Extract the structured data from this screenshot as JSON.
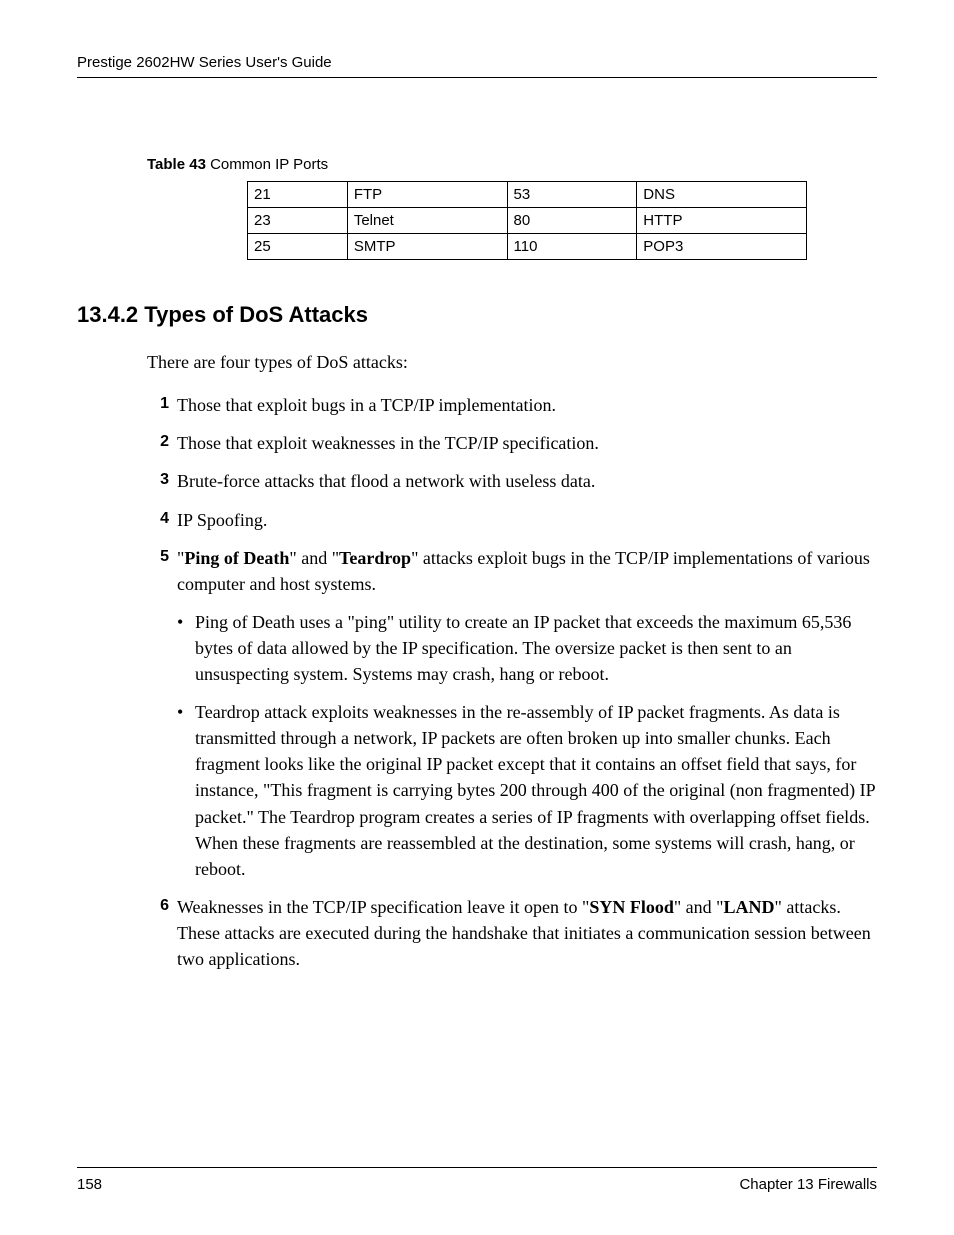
{
  "header": {
    "title": "Prestige 2602HW Series User's Guide"
  },
  "table": {
    "label_bold": "Table 43",
    "label_rest": "   Common IP Ports",
    "rows": [
      {
        "c1": "21",
        "c2": "FTP",
        "c3": "53",
        "c4": "DNS"
      },
      {
        "c1": "23",
        "c2": "Telnet",
        "c3": "80",
        "c4": "HTTP"
      },
      {
        "c1": "25",
        "c2": "SMTP",
        "c3": "110",
        "c4": "POP3"
      }
    ]
  },
  "section": {
    "heading": "13.4.2  Types of DoS Attacks",
    "intro": "There are four types of DoS attacks:",
    "items": {
      "n1": "1",
      "t1": "Those that exploit bugs in a TCP/IP implementation.",
      "n2": "2",
      "t2": "Those that exploit weaknesses in the TCP/IP specification.",
      "n3": "3",
      "t3": "Brute-force attacks that flood a network with useless data.",
      "n4": "4",
      "t4": "IP Spoofing.",
      "n5": "5",
      "t5a": "\"",
      "t5b": "Ping of Death",
      "t5c": "\" and \"",
      "t5d": "Teardrop",
      "t5e": "\" attacks exploit bugs in the TCP/IP implementations of various computer and host systems.",
      "sub1": "Ping of Death uses a \"ping\" utility to create an IP packet that exceeds the maximum 65,536 bytes of data allowed by the IP specification. The oversize packet is then sent to an unsuspecting system. Systems may crash, hang or reboot.",
      "sub2": "Teardrop attack exploits weaknesses in the re-assembly of IP packet fragments. As data is transmitted through a network, IP packets are often broken up into smaller chunks. Each fragment looks like the original IP packet except that it contains an offset field that says, for instance, \"This fragment is carrying bytes 200 through 400 of the original (non fragmented) IP packet.\" The Teardrop program creates a series of IP fragments with overlapping offset fields. When these fragments are reassembled at the destination, some systems will crash, hang, or reboot.",
      "n6": "6",
      "t6a": "Weaknesses in the TCP/IP specification leave it open to \"",
      "t6b": "SYN Flood",
      "t6c": "\" and \"",
      "t6d": "LAND",
      "t6e": "\" attacks. These attacks are executed during the handshake that initiates a communication session between two applications."
    }
  },
  "footer": {
    "page": "158",
    "chapter": "Chapter 13 Firewalls"
  }
}
